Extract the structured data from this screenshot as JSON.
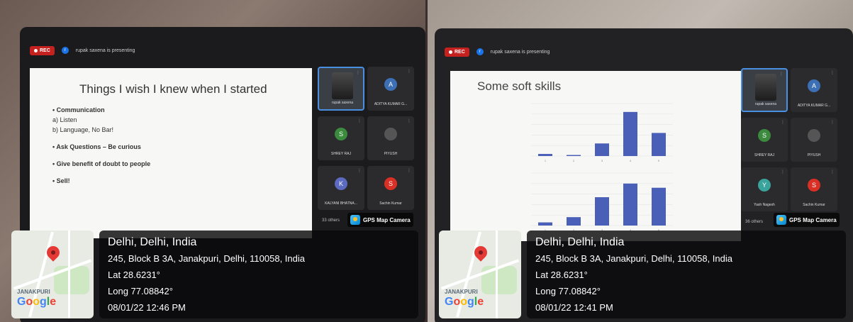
{
  "left": {
    "rec_label": "REC",
    "presenter_initial": "r",
    "presenting_text": "rupak saxena is presenting",
    "slide": {
      "title": "Things I wish I knew when I started",
      "lines": [
        "• Communication",
        "a)  Listen",
        "b)  Language, No Bar!",
        "• Ask Questions – Be curious",
        "• Give benefit of doubt to people",
        "• Sell!"
      ]
    },
    "participants": [
      {
        "name": "rupak saxena",
        "initial": "",
        "color": "#3a3f46",
        "active": true
      },
      {
        "name": "ADITYA KUMAR G...",
        "initial": "A",
        "color": "#3c6fb4"
      },
      {
        "name": "SHREY RAJ",
        "initial": "S",
        "color": "#3b8a3e"
      },
      {
        "name": "PIYUSH",
        "initial": "",
        "color": "#555"
      },
      {
        "name": "KALYANI BHATNA...",
        "initial": "K",
        "color": "#5c6bc0"
      },
      {
        "name": "Sachin Kumar",
        "initial": "S",
        "color": "#d93025"
      }
    ],
    "others": "33 others",
    "gps_label": "GPS Map Camera",
    "city": "Delhi, Delhi, India",
    "address": "245, Block B 3A, Janakpuri, Delhi, 110058, India",
    "lat": "Lat 28.6231°",
    "long": "Long 77.08842°",
    "datetime": "08/01/22 12:46 PM",
    "map_place": "JANAKPURI"
  },
  "right": {
    "rec_label": "REC",
    "presenter_initial": "r",
    "presenting_text": "rupak saxena is presenting",
    "slide_title": "Some soft skills",
    "participants": [
      {
        "name": "rupak saxena",
        "initial": "",
        "color": "#3a3f46",
        "active": true
      },
      {
        "name": "ADITYA KUMAR G...",
        "initial": "A",
        "color": "#3c6fb4"
      },
      {
        "name": "SHREY RAJ",
        "initial": "S",
        "color": "#3b8a3e"
      },
      {
        "name": "PIYUSH",
        "initial": "",
        "color": "#555"
      },
      {
        "name": "Yash Nagesh",
        "initial": "Y",
        "color": "#3aa39b"
      },
      {
        "name": "Sachin Kumar",
        "initial": "S",
        "color": "#d93025"
      }
    ],
    "others": "36 others",
    "gps_label": "GPS Map Camera",
    "city": "Delhi, Delhi, India",
    "address": "245, Block B 3A, Janakpuri, Delhi, 110058, India",
    "lat": "Lat 28.6231°",
    "long": "Long 77.08842°",
    "datetime": "08/01/22 12:41 PM",
    "map_place": "JANAKPURI"
  },
  "chart_data": [
    {
      "type": "bar",
      "categories": [
        "1",
        "2",
        "3",
        "4",
        "5"
      ],
      "values": [
        2,
        1,
        12,
        42,
        22
      ],
      "title": "",
      "ylim": [
        0,
        50
      ]
    },
    {
      "type": "bar",
      "categories": [
        "1",
        "2",
        "3",
        "4",
        "5"
      ],
      "values": [
        3,
        8,
        27,
        40,
        36
      ],
      "title": "",
      "ylim": [
        0,
        50
      ]
    }
  ],
  "colors": {
    "bar": "#4a5fb8",
    "accent": "#1a73e8",
    "rec": "#c5221f"
  }
}
